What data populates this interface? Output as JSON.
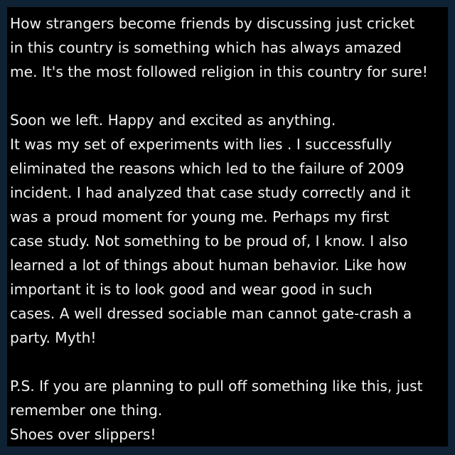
{
  "colors": {
    "background": "#0f2233",
    "panel": "#000000",
    "text": "#f2f2f2"
  },
  "paragraphs": [
    {
      "lines": [
        "How strangers become friends by discussing just cricket",
        "in this country is something which has always amazed",
        "me. It's the most followed religion in this country for sure!"
      ]
    },
    {
      "lines": [
        "Soon we left. Happy and excited as anything.",
        "It was my set of experiments with lies . I successfully",
        "eliminated the reasons which led to the failure of 2009",
        "incident. I had analyzed that case study correctly and it",
        "was a proud moment for young me. Perhaps my first",
        "case study. Not something to be proud of, I know. I also",
        "learned a lot of things about human behavior. Like how",
        "important it is to look good and wear good in such",
        "cases. A well dressed sociable man cannot gate-crash a",
        "party. Myth!"
      ]
    },
    {
      "lines": [
        "P.S. If you are planning to pull off something like this, just",
        "remember one thing.",
        "Shoes over slippers!"
      ]
    }
  ]
}
